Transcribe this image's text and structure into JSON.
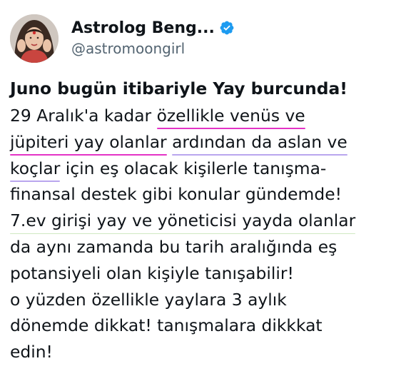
{
  "author": {
    "display_name": "Astrolog Beng...",
    "handle": "@astromoongirl",
    "verified": true,
    "verified_icon": "verified-badge-icon",
    "accent_color": "#1d9bf0"
  },
  "tweet": {
    "title": "Juno bugün itibariyle Yay burcunda!",
    "lines": [
      {
        "parts": [
          {
            "text": "29 Aralık'a kadar ",
            "mark": ""
          },
          {
            "text": "özellikle venüs ve",
            "mark": "pink"
          }
        ]
      },
      {
        "parts": [
          {
            "text": "jüpiteri yay olanlar",
            "mark": "pink"
          },
          {
            "text": " ",
            "mark": ""
          },
          {
            "text": "ardından da aslan ve",
            "mark": "purple"
          }
        ]
      },
      {
        "parts": [
          {
            "text": "koçlar",
            "mark": "purple"
          },
          {
            "text": " için eş olacak kişilerle tanışma-",
            "mark": ""
          }
        ]
      },
      {
        "parts": [
          {
            "text": "finansal destek gibi konular gündemde!",
            "mark": ""
          }
        ]
      },
      {
        "parts": [
          {
            "text": "7.ev girişi yay ve yöneticisi yayda olanlar",
            "mark": "green"
          }
        ]
      },
      {
        "parts": [
          {
            "text": "da aynı zamanda bu tarih aralığında eş",
            "mark": ""
          }
        ]
      },
      {
        "parts": [
          {
            "text": "potansiyeli olan kişiyle tanışabilir!",
            "mark": ""
          }
        ]
      },
      {
        "parts": [
          {
            "text": "o yüzden özellikle yaylara 3 aylık",
            "mark": ""
          }
        ]
      },
      {
        "parts": [
          {
            "text": "dönemde dikkat! tanışmalara dikkkat",
            "mark": ""
          }
        ]
      },
      {
        "parts": [
          {
            "text": "edin!",
            "mark": ""
          }
        ]
      }
    ]
  }
}
